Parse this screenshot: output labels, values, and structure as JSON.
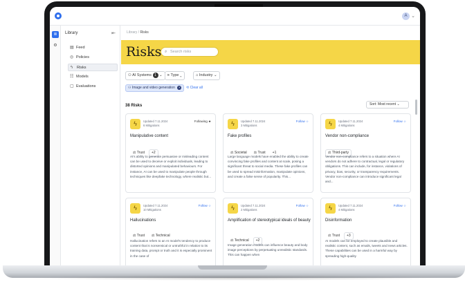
{
  "topbar": {
    "avatar_initial": "A",
    "avatar_chevron": "⌄"
  },
  "rail": [
    {
      "icon": "list-icon",
      "glyph": "≣"
    },
    {
      "icon": "gear-icon",
      "glyph": "⚙"
    }
  ],
  "sidebar": {
    "title": "Library",
    "collapse_glyph": "⇤",
    "items": [
      {
        "label": "Feed",
        "glyph": "▤"
      },
      {
        "label": "Policies",
        "glyph": "◎"
      },
      {
        "label": "Risks",
        "glyph": "ϟ"
      },
      {
        "label": "Models",
        "glyph": "☷"
      },
      {
        "label": "Evaluations",
        "glyph": "▢"
      }
    ]
  },
  "breadcrumb": {
    "parent": "Library",
    "sep": " / ",
    "current": "Risks"
  },
  "page": {
    "title": "Risks",
    "search_placeholder": "Search risks",
    "search_glyph": "⌕"
  },
  "filters": {
    "ai_systems": {
      "glyph": "⚇",
      "label": "AI Systems",
      "count": "1",
      "chev": "⌄"
    },
    "type": {
      "glyph": "⫸",
      "label": "Type",
      "chev": "⌄"
    },
    "industry": {
      "glyph": "⌂",
      "label": "Industry",
      "chev": "⌄"
    },
    "active_chip": {
      "glyph": "⚇",
      "label": "Image and video generation",
      "x": "×"
    },
    "clear": {
      "glyph": "⟲",
      "label": "Clear all"
    }
  },
  "results": {
    "count": "38 Risks",
    "sort": "Sort: Most recent ⌄"
  },
  "cards": [
    {
      "updated": "Updated 7.11.2024",
      "mitigations": "6 Mitigations",
      "follow": "Following ★",
      "following": true,
      "title": "Manipulative content",
      "tags": [
        "⚖ Trust",
        "+2"
      ],
      "desc": "AI's ability to generate persuasive or misleading content can be used to deceive or exploit individuals, leading to distorted opinions and manipulated behaviours. For instance, AI can be used to manipulate people through techniques like deepfake technology, where realistic but..."
    },
    {
      "updated": "Updated 7.11.2024",
      "mitigations": "3 Mitigations",
      "follow": "Follow ☆",
      "following": false,
      "title": "Fake profiles",
      "tags": [
        "⚖ Societal",
        "⚖ Trust",
        "+1"
      ],
      "desc": "Large language models have enabled the ability to create convincing fake profiles and content at scale, posing a significant threat to social media. These fake profiles can be used to spread misinformation, manipulate opinions, and create a false sense of popularity. This..."
    },
    {
      "updated": "Updated 7.11.2024",
      "mitigations": "4 Mitigations",
      "follow": "Follow ☆",
      "following": false,
      "title": "Vendor non-compliance",
      "tags": [
        "⚖ Third-party"
      ],
      "desc": "Vendor non-compliance refers to a situation where AI vendors do not adhere to contractual, legal or regulatory obligations. This can include, for instance, violations of privacy, bias, security, or transparency requirements. Vendor non-compliance can introduce significant legal and..."
    },
    {
      "updated": "Updated 7.11.2024",
      "mitigations": "10 Mitigations",
      "follow": "Follow ☆",
      "following": false,
      "title": "Hallucinations",
      "tags": [
        "⚖ Trust",
        "⚖ Technical"
      ],
      "desc": "Hallucination refers to an AI model's tendency to produce content that is nonsensical or untruthful in relation to its training data, prompt or truth and it is especially prominent in the case of"
    },
    {
      "updated": "Updated 7.11.2024",
      "mitigations": "2 Mitigations",
      "follow": "Follow ☆",
      "following": false,
      "title": "Amplification of stereotypical ideals of beauty",
      "tags": [
        "⚖ Technical",
        "+2"
      ],
      "desc": "Image generation models can influence beauty and body image perceptions by perpetuating unrealistic standards. This can happen when"
    },
    {
      "updated": "Updated 7.11.2024",
      "mitigations": "4 Mitigations",
      "follow": "Follow ☆",
      "following": false,
      "title": "Disinformation",
      "tags": [
        "⚖ Trust",
        "+3"
      ],
      "desc": "AI models can be employed to create plausible and realistic content, such as emails, tweets and news articles. These capabilities can be used in a harmful way by spreading high-quality"
    }
  ],
  "colors": {
    "accent": "#f5d647",
    "link": "#2f6fed",
    "chip_bg": "#dfe8fb"
  }
}
